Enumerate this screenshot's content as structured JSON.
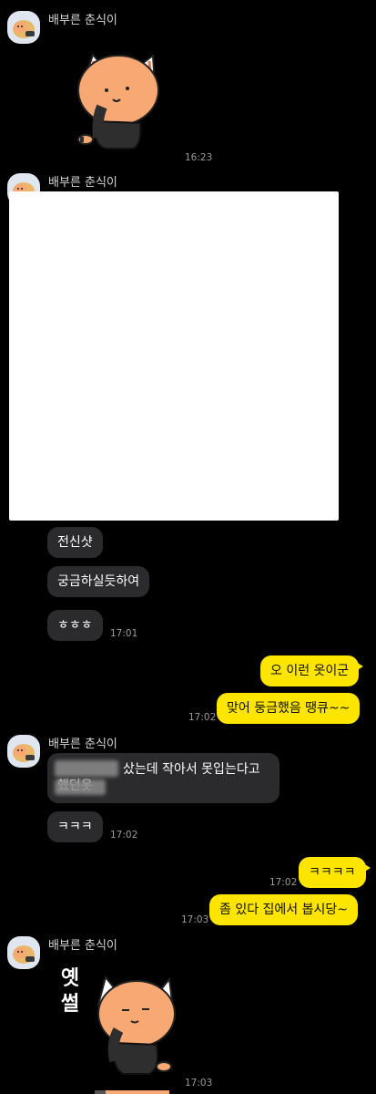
{
  "sender_name": "배부른 춘식이",
  "messages": {
    "m1_time": "16:23",
    "m3_text": "전신샷",
    "m4_text": "궁금하실듯하여",
    "m5_text": "ㅎㅎㅎ",
    "m5_time": "17:01",
    "o1_text": "오 이런 옷이군",
    "o2_text": "맞어 둥금했음 땡큐~~",
    "o2_time": "17:02",
    "m6_line1": "샀는데 작아서 못입는다고",
    "m6_line2": "했던옷",
    "m7_text": "ㅋㅋㅋ",
    "m7_time": "17:02",
    "o3_text": "ㅋㅋㅋㅋ",
    "o3_time": "17:02",
    "o4_text": "좀 있다 집에서 봅시당~",
    "o4_time": "17:03",
    "m8_sticker_text": "옛 썰",
    "m8_time": "17:03"
  },
  "colors": {
    "background": "#000000",
    "incoming_bubble": "#2b2b2d",
    "outgoing_bubble": "#fee500",
    "cat_face": "#f7a873",
    "cat_body": "#2e2e2e"
  }
}
